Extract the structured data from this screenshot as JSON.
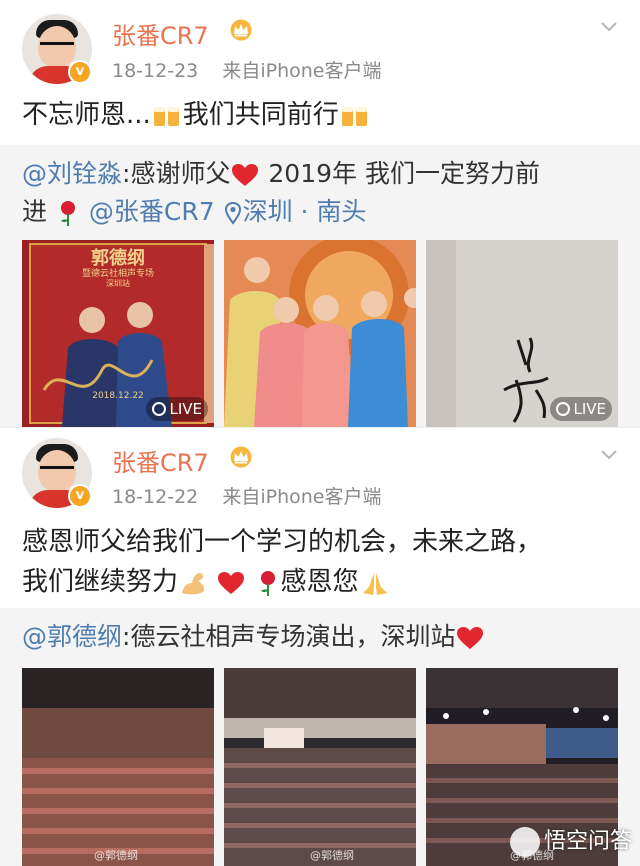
{
  "posts": [
    {
      "author": "张番CR7",
      "time": "18-12-23",
      "source": "来自iPhone客户端",
      "text_parts": [
        "不忘师恩...",
        "我们共同前行"
      ],
      "repost": {
        "mention": "@刘铨淼",
        "text": ":感谢师父",
        "text2": " 2019年 我们一定努力前",
        "text3": "进",
        "mention2": "@张番CR7",
        "location": "深圳 · 南头"
      },
      "images": [
        {
          "badge": "LIVE"
        },
        {
          "badge": ""
        },
        {
          "badge": "LIVE"
        }
      ]
    },
    {
      "author": "张番CR7",
      "time": "18-12-22",
      "source": "来自iPhone客户端",
      "text_line1": "感恩师父给我们一个学习的机会，未来之路，",
      "text_line2": "我们继续努力",
      "text_line2_end": "感恩您",
      "repost": {
        "mention": "@郭德纲",
        "text": ":德云社相声专场演出，深圳站"
      },
      "images": [
        {
          "watermark": "@郭德纲"
        },
        {
          "watermark": "@郭德纲"
        },
        {
          "watermark": "@郭德纲"
        }
      ]
    }
  ],
  "poster_text": {
    "title": "郭德纲",
    "subtitle": "暨德云社相声专场",
    "station": "深圳站",
    "date": "2018.12.22"
  },
  "site_watermark": "悟空问答",
  "colors": {
    "name": "#eb7350",
    "link": "#507daf",
    "meta": "#8a8a8a",
    "repost_bg": "#f4f4f4"
  },
  "icons": [
    "chevron-down-icon",
    "crown-icon",
    "verified-badge-icon",
    "location-icon",
    "live-photo-icon",
    "beer-emoji",
    "heart-emoji",
    "rose-emoji",
    "muscle-emoji",
    "pray-emoji"
  ]
}
